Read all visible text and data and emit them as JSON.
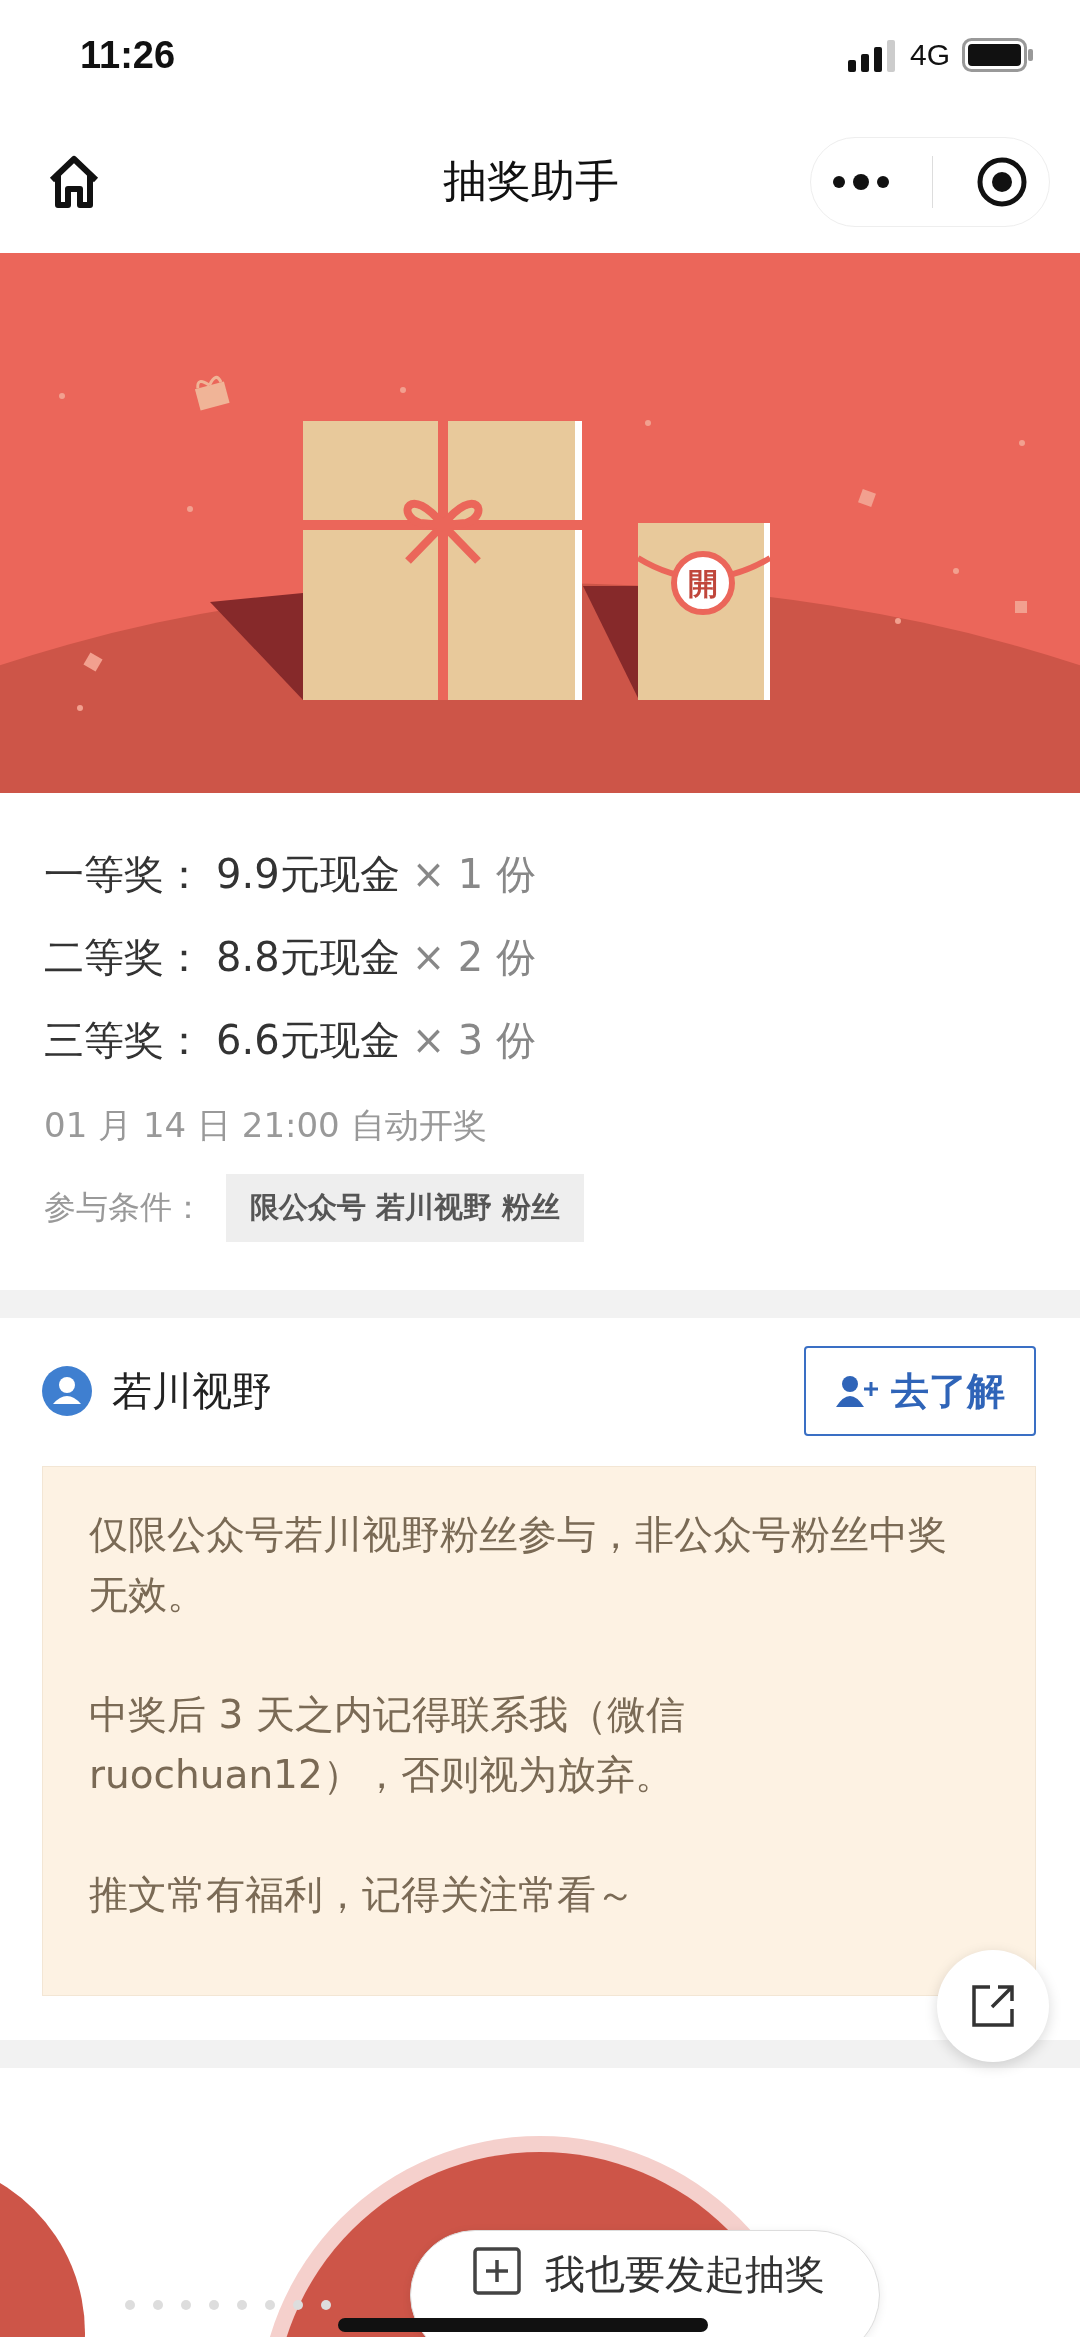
{
  "status_bar": {
    "time": "11:26",
    "network": "4G"
  },
  "nav": {
    "title": "抽奖助手"
  },
  "banner": {
    "seal": "開"
  },
  "prizes": [
    {
      "tier": "一等奖：",
      "prize": "9.9元现金",
      "count": "× 1 份"
    },
    {
      "tier": "二等奖：",
      "prize": "8.8元现金",
      "count": "× 2 份"
    },
    {
      "tier": "三等奖：",
      "prize": "6.6元现金",
      "count": "× 3 份"
    }
  ],
  "draw_time": "01 月 14 日 21:00 自动开奖",
  "condition": {
    "label": "参与条件：",
    "tag": "限公众号 若川视野 粉丝"
  },
  "account": {
    "name": "若川视野",
    "button": "去了解"
  },
  "note": [
    "仅限公众号若川视野粉丝参与，非公众号粉丝中奖无效。",
    "中奖后 3 天之内记得联系我（微信 ruochuan12），否则视为放弃。",
    "推文常有福利，记得关注常看～"
  ],
  "start_button": "我也要发起抽奖"
}
